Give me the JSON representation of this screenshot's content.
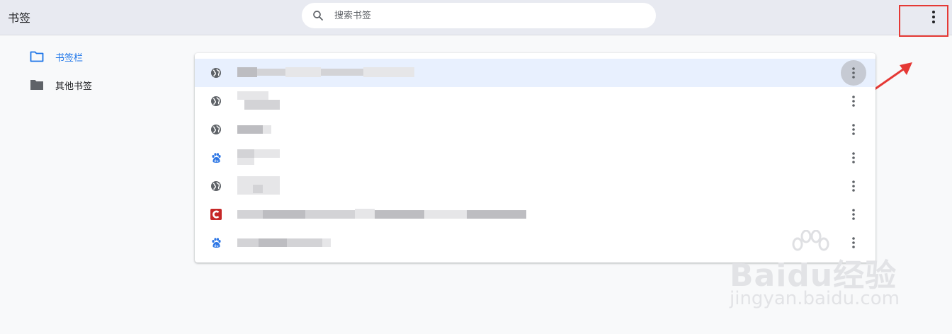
{
  "header": {
    "title": "书签",
    "search": {
      "placeholder": "搜索书签",
      "value": "",
      "icon": "search-icon"
    },
    "menu_icon": "more-vert-icon"
  },
  "sidebar": {
    "items": [
      {
        "label": "书签栏",
        "icon": "folder-outline-icon",
        "active": true
      },
      {
        "label": "其他书签",
        "icon": "folder-filled-icon",
        "active": false
      }
    ]
  },
  "bookmarks": [
    {
      "favicon": "globe-icon",
      "selected": true
    },
    {
      "favicon": "globe-icon",
      "selected": false
    },
    {
      "favicon": "globe-icon",
      "selected": false
    },
    {
      "favicon": "baidu-paw-icon",
      "selected": false
    },
    {
      "favicon": "globe-icon",
      "selected": false
    },
    {
      "favicon": "c-logo-icon",
      "selected": false
    },
    {
      "favicon": "baidu-paw-icon",
      "selected": false
    }
  ],
  "annotation": {
    "color": "#e53935"
  },
  "watermark": {
    "main": "Baidu经验",
    "sub": "jingyan.baidu.com"
  },
  "colors": {
    "accent": "#1a73e8",
    "selected_row": "#e8f0fe",
    "topbar": "#e8eaf1"
  }
}
